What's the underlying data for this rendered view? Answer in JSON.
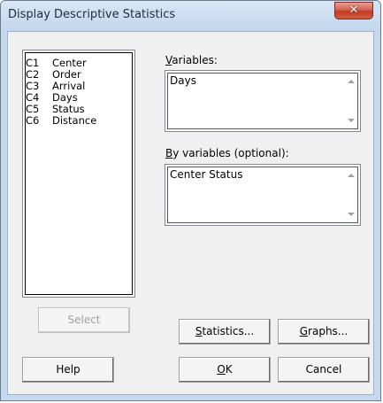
{
  "window": {
    "title": "Display Descriptive Statistics",
    "close_label": "✕"
  },
  "variable_list": {
    "items": [
      {
        "col": "C1",
        "name": "Center"
      },
      {
        "col": "C2",
        "name": "Order"
      },
      {
        "col": "C3",
        "name": "Arrival"
      },
      {
        "col": "C4",
        "name": "Days"
      },
      {
        "col": "C5",
        "name": "Status"
      },
      {
        "col": "C6",
        "name": "Distance"
      }
    ]
  },
  "variables": {
    "label_first": "V",
    "label_rest": "ariables:",
    "value": "Days"
  },
  "by_variables": {
    "label_first": "B",
    "label_rest": "y variables (optional):",
    "value": "Center Status"
  },
  "buttons": {
    "select": "Select",
    "statistics_first": "S",
    "statistics_rest": "tatistics...",
    "graphs_first": "G",
    "graphs_rest": "raphs...",
    "help": "Help",
    "ok_first": "O",
    "ok_rest": "K",
    "cancel": "Cancel"
  },
  "icons": {
    "close": "close-icon",
    "scroll_up": "scroll-up-arrow-icon",
    "scroll_down": "scroll-down-arrow-icon"
  },
  "colors": {
    "title_bar": "#c4d8ee",
    "close_button": "#c13a26",
    "dialog_bg": "#f0f0f0"
  }
}
